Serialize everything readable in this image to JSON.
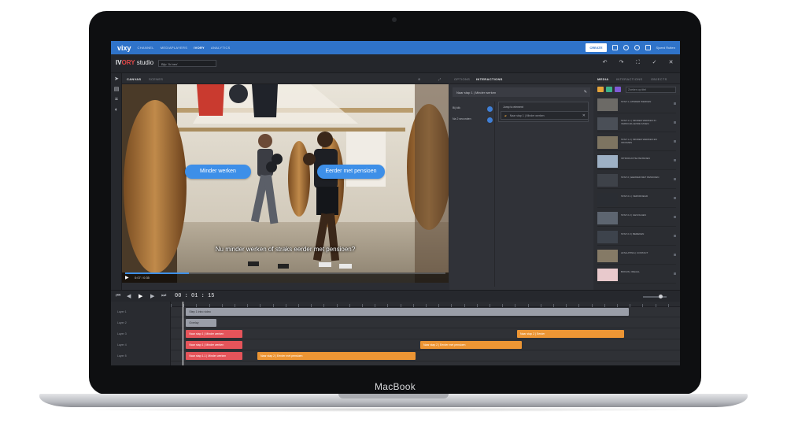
{
  "device": {
    "label": "MacBook"
  },
  "topnav": {
    "logo": "vixy",
    "items": [
      "CHANNEL",
      "MEDIAPLAYERS",
      "IVORY",
      "ANALYTICS"
    ],
    "active_index": 2,
    "create_label": "CREATE",
    "user": "Sjoerd Rutten"
  },
  "studio": {
    "logo_prefix": "IV",
    "logo_accent": "ORY",
    "logo_suffix": "studio",
    "project": "Bijv. 'Ik ben'"
  },
  "canvas": {
    "tabs": [
      "CANVAS",
      "SCENES"
    ],
    "active_tab": 0,
    "buttons": [
      {
        "label": "Minder werken",
        "color": "#3d8fe8"
      },
      {
        "label": "Eerder met pensioen",
        "color": "#3d8fe8"
      }
    ],
    "subtitle": "Nu minder werken of straks eerder met pensioen?",
    "player_time": "0:07 / 0:35"
  },
  "interactions": {
    "tabs": [
      "OPTIONS",
      "INTERACTIONS"
    ],
    "active_tab": 1,
    "title": "Naar stap 1 | Minder werken",
    "choices": [
      "Bij klik",
      "Na 2 seconden"
    ],
    "jump_label": "Jump to element",
    "jump_value": "Naar stap 1 | Minder werken"
  },
  "media": {
    "tabs": [
      "MEDIA",
      "INTERACTIONS",
      "OBJECTS"
    ],
    "active_tab": 0,
    "search_placeholder": "Zoeken op titel",
    "tool_colors": [
      "#e6a43a",
      "#3bb38a",
      "#7f5bd6",
      "#4d8fe0"
    ],
    "items": [
      {
        "title": "STAP 1 | MINDER WERKEN"
      },
      {
        "title": "STAP 1.1 | MINDER WERKEN IN VERSCHILLENDE FASES"
      },
      {
        "title": "STAP 1.2 | MINDER WERKEN EN INKOMEN"
      },
      {
        "title": "INTRODUCTIE PENSIOEN"
      },
      {
        "title": "STAP 2 | EERDER MET PENSIOEN"
      },
      {
        "title": "STAP 2.1 | VERVROEGD"
      },
      {
        "title": "STAP 2.2 | GEVOLGEN"
      },
      {
        "title": "STAP 2.3 | BEREKEN"
      },
      {
        "title": "AFSLUITING | CONTACT"
      },
      {
        "title": "BONUS | IDEAAL"
      }
    ],
    "thumb_colors": [
      "#6c6a66",
      "#4a4f57",
      "#7d7461",
      "#9db0c4",
      "#3e4249",
      "#2a2d33",
      "#5d6570",
      "#3d434c",
      "#857a66",
      "#e8c9cc"
    ]
  },
  "timeline": {
    "timecode": "00 : 01 : 15",
    "tracks": [
      "Layer 1",
      "Layer 2",
      "Layer 3",
      "Layer 4",
      "Layer 5"
    ],
    "clips": [
      {
        "track": 0,
        "start": 0.03,
        "end": 0.9,
        "color": "grey",
        "label": "Step 1 Intro video"
      },
      {
        "track": 1,
        "start": 0.03,
        "end": 0.09,
        "color": "grey",
        "label": "Overlay"
      },
      {
        "track": 2,
        "start": 0.03,
        "end": 0.14,
        "color": "red",
        "label": "Naar stap 1 | Minder werken"
      },
      {
        "track": 2,
        "start": 0.68,
        "end": 0.89,
        "color": "orange",
        "label": "Naar stap 2 | Eerder"
      },
      {
        "track": 3,
        "start": 0.03,
        "end": 0.14,
        "color": "red",
        "label": "Naar stap 1 | Minder werken"
      },
      {
        "track": 3,
        "start": 0.49,
        "end": 0.69,
        "color": "orange",
        "label": "Naar stap 2 | Eerder met pensioen"
      },
      {
        "track": 4,
        "start": 0.03,
        "end": 0.14,
        "color": "red",
        "label": "Naar stap 1.1 | Minder werken"
      },
      {
        "track": 4,
        "start": 0.17,
        "end": 0.48,
        "color": "orange",
        "label": "Naar stap 2 | Eerder met pensioen"
      }
    ]
  }
}
